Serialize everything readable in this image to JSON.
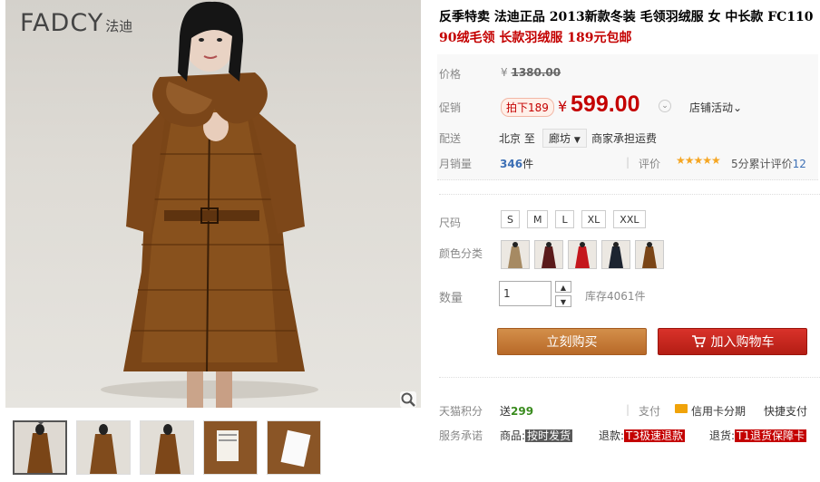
{
  "brand": {
    "name_en": "FADCY",
    "name_cn": "法迪"
  },
  "product": {
    "title": "反季特卖 法迪正品 2013新款冬装 毛领羽绒服 女 中长款 FC110",
    "subtitle": "90绒毛领 长款羽绒服 189元包邮"
  },
  "price": {
    "label": "价格",
    "currency": "¥",
    "original": "1380.00",
    "promo_label": "促销",
    "promo_tag": "拍下189",
    "promo_value": "599.00",
    "store_activity": "店铺活动"
  },
  "shipping": {
    "label": "配送",
    "from": "北京 至",
    "to": "廊坊",
    "fee": "商家承担运费"
  },
  "sales": {
    "label": "月销量",
    "count": "346",
    "unit": "件",
    "rating_label": "评价",
    "stars": "★★★★★",
    "rating_text": "5分累计评价",
    "rating_count": "12"
  },
  "options": {
    "size_label": "尺码",
    "sizes": [
      "S",
      "M",
      "L",
      "XL",
      "XXL"
    ],
    "color_label": "颜色分类",
    "color_count": 5
  },
  "quantity": {
    "label": "数量",
    "value": "1",
    "stock": "库存4061件"
  },
  "actions": {
    "buy_now": "立刻购买",
    "add_cart": "加入购物车"
  },
  "points": {
    "label": "天猫积分",
    "prefix": "送",
    "value": "299"
  },
  "payment": {
    "label": "支付",
    "credit": "信用卡分期",
    "fast": "快捷支付"
  },
  "service": {
    "label": "服务承诺",
    "items": [
      {
        "key": "商品:",
        "tag": "按时发货"
      },
      {
        "key": "退款:",
        "tag": "T3极速退款"
      },
      {
        "key": "退货:",
        "tag": "T1退货保障卡"
      }
    ]
  },
  "colors": {
    "accent_red": "#c40000",
    "buy_orange": "#c27a33",
    "cart_red": "#c4261d",
    "sales_blue": "#3c6fb5"
  }
}
